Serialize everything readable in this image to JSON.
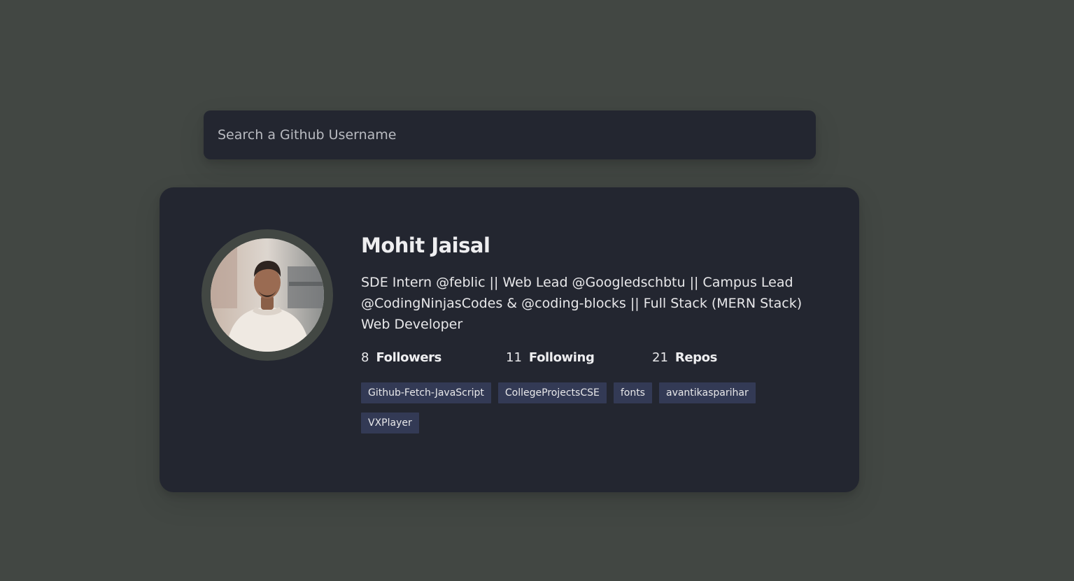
{
  "search": {
    "placeholder": "Search a Github Username",
    "value": ""
  },
  "profile": {
    "name": "Mohit Jaisal",
    "bio": "SDE Intern @feblic || Web Lead @Googledschbtu || Campus Lead @CodingNinjasCodes & @coding-blocks || Full Stack (MERN Stack) Web Developer",
    "avatar_icon": "user-photo",
    "stats": {
      "followers": {
        "count": "8",
        "label": "Followers"
      },
      "following": {
        "count": "11",
        "label": "Following"
      },
      "repos": {
        "count": "21",
        "label": "Repos"
      }
    },
    "repos": [
      "Github-Fetch-JavaScript",
      "CollegeProjectsCSE",
      "fonts",
      "avantikasparihar",
      "VXPlayer"
    ]
  },
  "colors": {
    "page_background": "#424743",
    "card_background": "#232630",
    "repo_tag_background": "#333a55",
    "text": "#e8e8ea"
  }
}
